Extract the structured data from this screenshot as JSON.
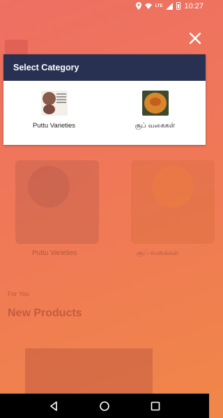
{
  "status_bar": {
    "time": "10:27",
    "network": "LTE",
    "icons": [
      "location-icon",
      "wifi-icon",
      "signal-icon",
      "battery-icon"
    ]
  },
  "background": {
    "categories": [
      {
        "label": "Puttu Varieties"
      },
      {
        "label": "சூப் வகைகள்"
      }
    ],
    "for_you": "For You",
    "section_title": "New Products"
  },
  "dialog": {
    "title": "Select Category",
    "items": [
      {
        "label": "Puttu Varieties",
        "icon": "puttu-thumbnail"
      },
      {
        "label": "சூப் வகைகள்",
        "icon": "soup-thumbnail"
      }
    ]
  },
  "colors": {
    "header_bg": "#283151",
    "overlay_start": "#ee6f63",
    "overlay_end": "#f08748"
  },
  "nav": {
    "buttons": [
      "back-icon",
      "home-icon",
      "recents-icon"
    ]
  }
}
